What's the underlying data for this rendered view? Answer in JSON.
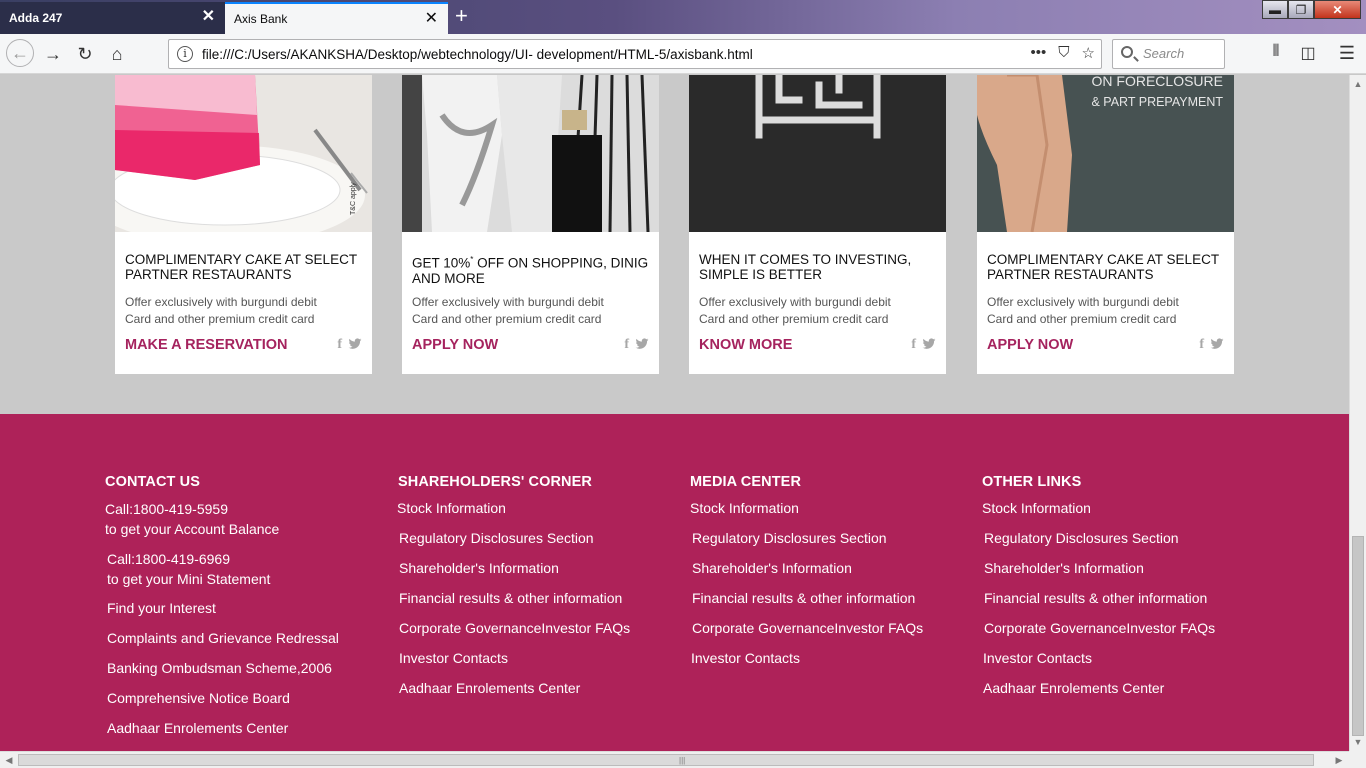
{
  "browser": {
    "tabs": [
      {
        "title": "Adda 247",
        "active": false
      },
      {
        "title": "Axis Bank",
        "active": true
      }
    ],
    "new_tab_icon": "plus-icon",
    "url": "file:///C:/Users/AKANKSHA/Desktop/webtechnology/UI- development/HTML-5/axisbank.html",
    "search_placeholder": "Search",
    "window_controls": [
      "minimize",
      "maximize",
      "close"
    ],
    "toolbar_icons": [
      "back-icon",
      "forward-icon",
      "reload-icon",
      "home-icon",
      "info-icon",
      "more-icon",
      "pocket-icon",
      "bookmark-star-icon",
      "library-icon",
      "sidebar-icon",
      "menu-icon"
    ]
  },
  "cards": [
    {
      "title": "COMPLIMENTARY CAKE AT SELECT PARTNER RESTAURANTS",
      "desc1": "Offer exclusively with burgundi debit",
      "desc2": "Card and other premium credit card",
      "cta": "MAKE A RESERVATION",
      "image_caption": "T&C apply",
      "image_label": "cake-image"
    },
    {
      "title_pre": "GET 10%",
      "title_sup": "*",
      "title_post": " OFF ON SHOPPING, DINIG AND MORE",
      "desc1": "Offer exclusively with burgundi debit",
      "desc2": "Card and other premium credit card",
      "cta": "APPLY NOW",
      "image_label": "fashion-image"
    },
    {
      "title": "WHEN IT COMES TO INVESTING, SIMPLE IS BETTER",
      "desc1": "Offer exclusively with burgundi debit",
      "desc2": "Card and other premium credit card",
      "cta": "KNOW MORE",
      "image_label": "maze-image"
    },
    {
      "title": "COMPLIMENTARY CAKE AT SELECT PARTNER RESTAURANTS",
      "desc1": "Offer exclusively with burgundi debit",
      "desc2": "Card and other premium credit card",
      "cta": "APPLY NOW",
      "image_text1": "ON FORECLOSURE",
      "image_text2": "& PART PREPAYMENT",
      "image_label": "loan-image"
    }
  ],
  "social_icons": {
    "facebook": "f",
    "twitter": "twitter-icon"
  },
  "footer": {
    "contact": {
      "heading": "CONTACT US",
      "call1": "Call:1800-419-5959",
      "call1_desc": "to get your Account Balance",
      "call2": "Call:1800-419-6969",
      "call2_desc": "to get your Mini Statement",
      "links": [
        "Find your Interest",
        "Complaints and Grievance Redressal",
        "Banking Ombudsman Scheme,2006",
        "Comprehensive Notice Board",
        "Aadhaar Enrolements Center"
      ]
    },
    "shareholders": {
      "heading": "SHAREHOLDERS' CORNER",
      "links": [
        "Stock Information",
        "Regulatory Disclosures Section",
        "Shareholder's Information",
        "Financial results & other information",
        "Corporate GovernanceInvestor FAQs",
        "Investor Contacts",
        "Aadhaar Enrolements Center"
      ]
    },
    "media": {
      "heading": "MEDIA CENTER",
      "links": [
        "Stock Information",
        "Regulatory Disclosures Section",
        "Shareholder's Information",
        "Financial results & other information",
        "Corporate GovernanceInvestor FAQs",
        "Investor Contacts"
      ]
    },
    "other": {
      "heading": "OTHER LINKS",
      "links": [
        "Stock Information",
        "Regulatory Disclosures Section",
        "Shareholder's Information",
        "Financial results & other information",
        "Corporate GovernanceInvestor FAQs",
        "Investor Contacts",
        "Aadhaar Enrolements Center"
      ]
    }
  },
  "colors": {
    "brand": "#ae2259",
    "cta": "#a5235e",
    "page_bg": "#c9c9c9"
  }
}
